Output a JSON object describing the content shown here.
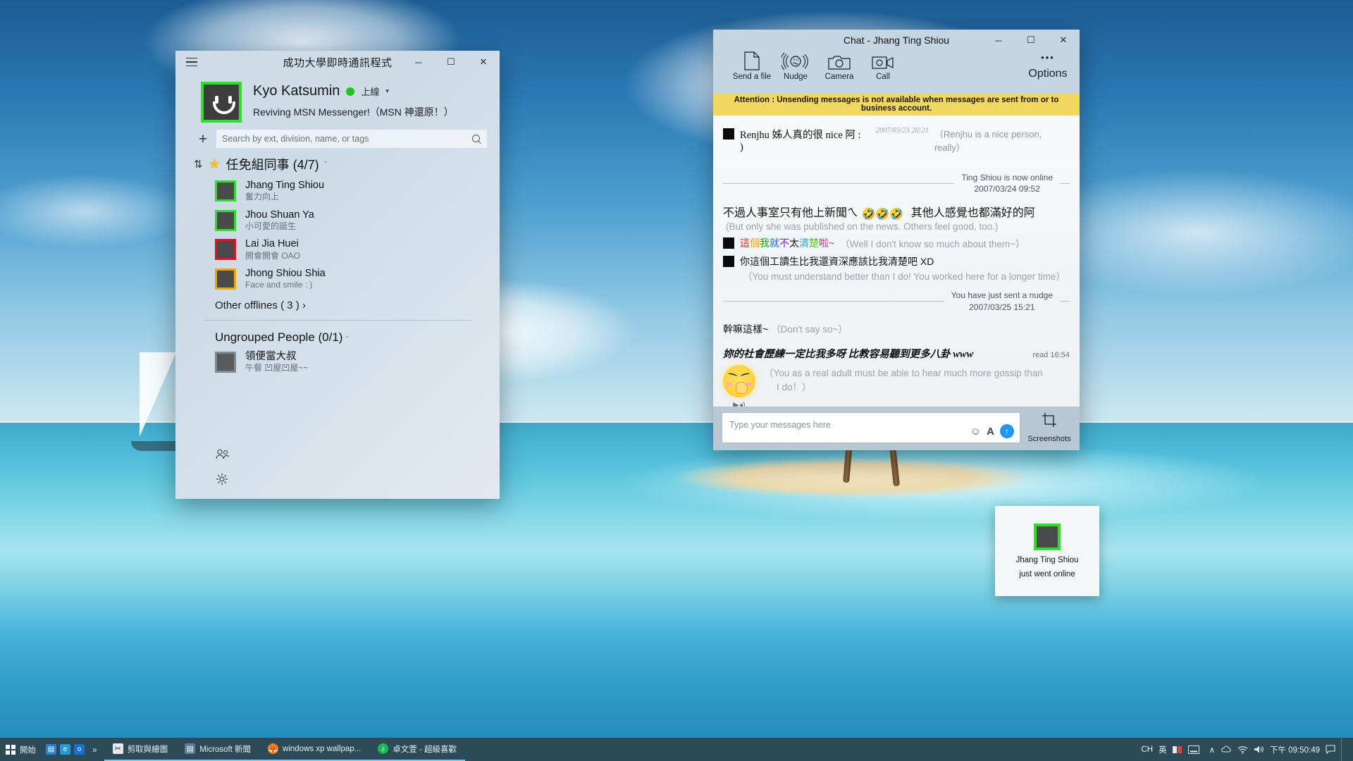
{
  "contacts_window": {
    "title": "成功大學即時通訊程式",
    "menu_icon": "hamburger-icon",
    "window_controls": {
      "minimize": "─",
      "maximize": "☐",
      "close": "✕"
    },
    "profile": {
      "name": "Kyo Katsumin",
      "status": "上線",
      "status_color": "#19c919",
      "caret": "▾",
      "tagline": "Reviving MSN Messenger!（MSN 神還原！）"
    },
    "search": {
      "placeholder": "Search by ext, division, name, or tags",
      "add_icon": "plus-icon",
      "search_icon": "search-icon"
    },
    "group": {
      "sort_icon": "⇅",
      "star_icon": "★",
      "title": "任免組同事 (4/7)",
      "caret": "ˇ"
    },
    "contacts": [
      {
        "name": "Jhang Ting Shiou",
        "message": "奮力向上",
        "presence": "online"
      },
      {
        "name": "Jhou Shuan Ya",
        "message": "小可愛的誕生",
        "presence": "online"
      },
      {
        "name": "Lai Jia Huei",
        "message": "開會開會 OAO",
        "presence": "busy"
      },
      {
        "name": "Jhong Shiou Shia",
        "message": "Face and smile : )",
        "presence": "away"
      }
    ],
    "other_offlines": "Other offlines ( 3 ) ›",
    "ungrouped_title": "Ungrouped People (0/1)",
    "ungrouped_caret": "ˇ",
    "ungrouped_contacts": [
      {
        "name": "領便當大叔",
        "message": "午餐 凹屋凹屋~~",
        "presence": "offline"
      }
    ],
    "footer": {
      "people_icon": "people-icon",
      "settings_icon": "gear-icon"
    }
  },
  "chat_window": {
    "title": "Chat - Jhang Ting Shiou",
    "window_controls": {
      "minimize": "─",
      "maximize": "☐",
      "close": "✕"
    },
    "toolbar": [
      {
        "label": "Send a file",
        "icon": "file-icon"
      },
      {
        "label": "Nudge",
        "icon": "nudge-icon"
      },
      {
        "label": "Camera",
        "icon": "camera-icon"
      },
      {
        "label": "Call",
        "icon": "video-call-icon"
      }
    ],
    "options_label": "Options",
    "options_dots": "•••",
    "attention": "Attention : Unsending messages is not available when messages are sent from or to business account.",
    "messages": [
      {
        "kind": "text-with-timestamp",
        "text": "Renjhu 姊人真的很 nice 阿 : )",
        "timestamp": "2007/03/23 20:21",
        "translation": "（Renjhu is a nice person, really）"
      },
      {
        "kind": "system",
        "line1": "Ting Shiou is now online",
        "line2": "2007/03/24 09:52"
      },
      {
        "kind": "plain",
        "text": "不過人事室只有他上新聞ㄟ",
        "emojis": "🤣🤣🤣",
        "tail": "其他人感覺也都滿好的阿",
        "translation": "(But only she was published on the news. Others feel good, too.)"
      },
      {
        "kind": "rainbow",
        "parts": [
          "這",
          "個",
          "我",
          "就",
          "不",
          "太",
          "清",
          "楚",
          "啦~"
        ],
        "translation": "（Well I don't know so much about them~）"
      },
      {
        "kind": "plain-square",
        "text": "你這個工讀生比我還資深應該比我清楚吧 XD",
        "translation": "（You must understand better than I do! You worked here for a longer time）"
      },
      {
        "kind": "system",
        "line1": "You have just sent a nudge",
        "line2": "2007/03/25 15:21"
      },
      {
        "kind": "plain",
        "text": "幹嘛這樣~",
        "translation": "（Don't say so~）"
      },
      {
        "kind": "italic-voice",
        "text": "妳的社會歷練一定比我多呀 比教容易聽到更多八卦 www",
        "read": "read 16:54",
        "translation_line1": "（You as a real adult must be able to hear much more gossip than",
        "translation_line2": "I do！）",
        "sticker": "smirk-sticker",
        "play_icon": "▶◂)"
      }
    ],
    "input": {
      "placeholder": "Type your messages here",
      "emoji_icon": "☺",
      "font_icon": "A",
      "send_icon": "↑"
    },
    "screenshots": {
      "label": "Screenshots",
      "icon": "crop-icon"
    }
  },
  "toast": {
    "name": "Jhang Ting Shiou",
    "subtitle": "just went online",
    "avatar_presence": "online"
  },
  "taskbar": {
    "start_label": "開始",
    "quick_launch": [
      {
        "name": "file-explorer-icon",
        "glyph": "▤",
        "color": "#2f7fd4"
      },
      {
        "name": "edge-icon",
        "glyph": "e",
        "color": "#1f9cd8"
      },
      {
        "name": "outlook-icon",
        "glyph": "o",
        "color": "#1a6fd4"
      }
    ],
    "overflow_chevron": "»",
    "items": [
      {
        "label": "剪取與繪圖",
        "icon": "snip-tool-icon",
        "color": "#e8ebee",
        "active": true
      },
      {
        "label": "Microsoft 新聞",
        "icon": "news-icon",
        "color": "#5a7e9a",
        "active": true
      },
      {
        "label": "windows xp wallpap...",
        "icon": "firefox-icon",
        "color": "#f08a24",
        "active": true
      },
      {
        "label": "卓文萱 - 超級喜歡",
        "icon": "media-icon",
        "color": "#1db954",
        "active": true
      }
    ],
    "tray": {
      "input_mode": "CH",
      "ime_label": "英",
      "up_chevron": "∧",
      "clock_time": "下午 09:50:49",
      "icons": [
        "network-icon",
        "sound-icon",
        "battery-icon"
      ]
    }
  }
}
